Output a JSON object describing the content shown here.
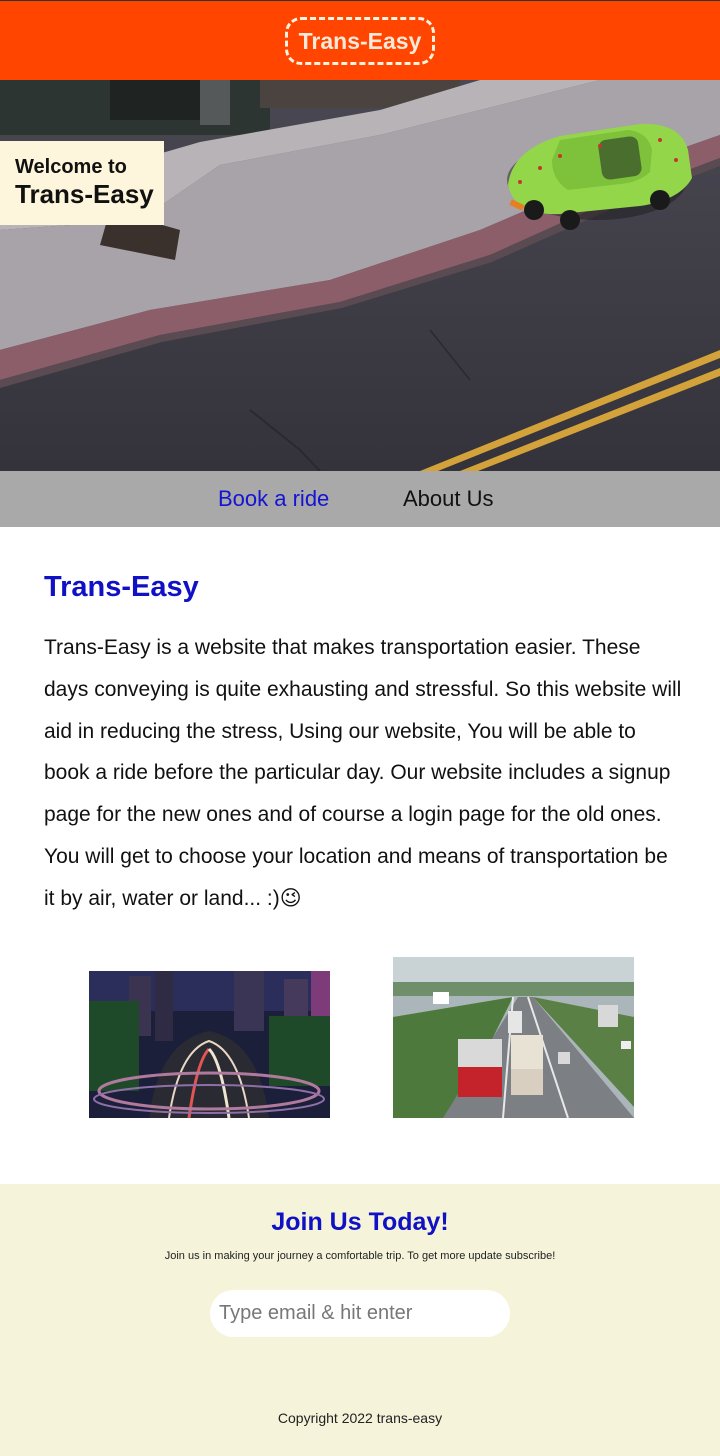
{
  "header": {
    "logo_text": "Trans-Easy"
  },
  "hero": {
    "welcome_line1": "Welcome to",
    "welcome_line2": "Trans-Easy",
    "image_icon": "street-car-photo"
  },
  "nav": {
    "items": [
      {
        "label": "Book a ride"
      },
      {
        "label": "About Us"
      }
    ]
  },
  "main": {
    "title": "Trans-Easy",
    "paragraph": "Trans-Easy is a website that makes transportation easier. These days conveying is quite exhausting and stressful. So this website will aid in reducing the stress, Using our website, You will be able to book a ride before the particular day. Our website includes a signup page for the new ones and of course a login page for the old ones. You will get to choose your location and means of transportation be it by air, water or land... :)😉",
    "images": [
      {
        "icon": "city-traffic-night-photo"
      },
      {
        "icon": "highway-trucks-photo"
      }
    ]
  },
  "footer": {
    "heading": "Join Us Today!",
    "subtext": "Join us in making your journey a comfortable trip. To get more update subscribe!",
    "email_placeholder": "Type email & hit enter",
    "copyright": "Copyright 2022 trans-easy"
  },
  "colors": {
    "header_bg": "#ff4500",
    "nav_bg": "#a9a9a9",
    "link_blue": "#1414d2",
    "title_blue": "#1010c4",
    "footer_bg": "#f5f4db",
    "welcome_bg": "#fdf5dc"
  }
}
